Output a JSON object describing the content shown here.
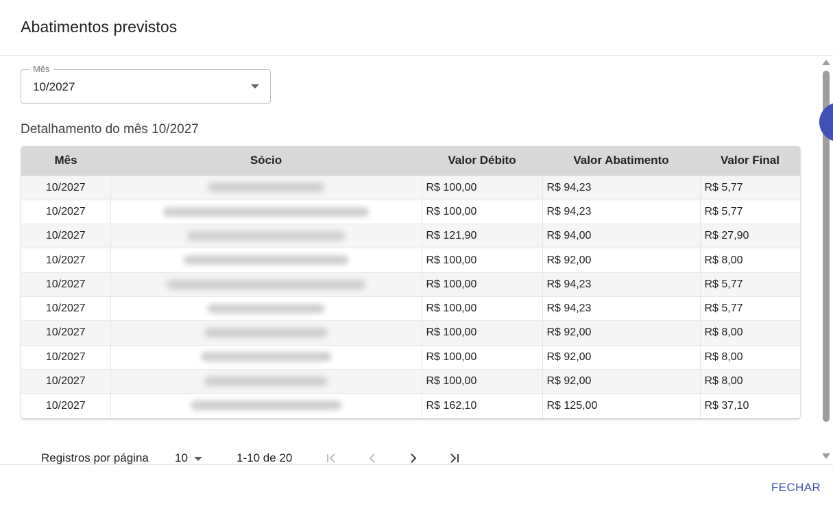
{
  "dialog": {
    "title": "Abatimentos previstos",
    "close_label": "FECHAR"
  },
  "month_select": {
    "label": "Mês",
    "value": "10/2027"
  },
  "detail_title": "Detalhamento do mês 10/2027",
  "table": {
    "headers": {
      "mes": "Mês",
      "socio": "Sócio",
      "valor_debito": "Valor Débito",
      "valor_abatimento": "Valor Abatimento",
      "valor_final": "Valor Final"
    },
    "rows": [
      {
        "mes": "10/2027",
        "valor_debito": "R$ 100,00",
        "valor_abatimento": "R$ 94,23",
        "valor_final": "R$ 5,77"
      },
      {
        "mes": "10/2027",
        "valor_debito": "R$ 100,00",
        "valor_abatimento": "R$ 94,23",
        "valor_final": "R$ 5,77"
      },
      {
        "mes": "10/2027",
        "valor_debito": "R$ 121,90",
        "valor_abatimento": "R$ 94,00",
        "valor_final": "R$ 27,90"
      },
      {
        "mes": "10/2027",
        "valor_debito": "R$ 100,00",
        "valor_abatimento": "R$ 92,00",
        "valor_final": "R$ 8,00"
      },
      {
        "mes": "10/2027",
        "valor_debito": "R$ 100,00",
        "valor_abatimento": "R$ 94,23",
        "valor_final": "R$ 5,77"
      },
      {
        "mes": "10/2027",
        "valor_debito": "R$ 100,00",
        "valor_abatimento": "R$ 94,23",
        "valor_final": "R$ 5,77"
      },
      {
        "mes": "10/2027",
        "valor_debito": "R$ 100,00",
        "valor_abatimento": "R$ 92,00",
        "valor_final": "R$ 8,00"
      },
      {
        "mes": "10/2027",
        "valor_debito": "R$ 100,00",
        "valor_abatimento": "R$ 92,00",
        "valor_final": "R$ 8,00"
      },
      {
        "mes": "10/2027",
        "valor_debito": "R$ 100,00",
        "valor_abatimento": "R$ 92,00",
        "valor_final": "R$ 8,00"
      },
      {
        "mes": "10/2027",
        "valor_debito": "R$ 162,10",
        "valor_abatimento": "R$ 125,00",
        "valor_final": "R$ 37,10"
      }
    ]
  },
  "pagination": {
    "rows_per_page_label": "Registros por página",
    "rows_per_page": "10",
    "range": "1-10 de 20"
  },
  "colors": {
    "accent": "#3f51b5",
    "header_bg": "#d8d8d8",
    "row_alt_bg": "#f5f5f5"
  },
  "icons": {
    "select_caret": "chevron-down-icon",
    "first_page": "first-page-icon",
    "prev_page": "chevron-left-icon",
    "next_page": "chevron-right-icon",
    "last_page": "last-page-icon"
  }
}
